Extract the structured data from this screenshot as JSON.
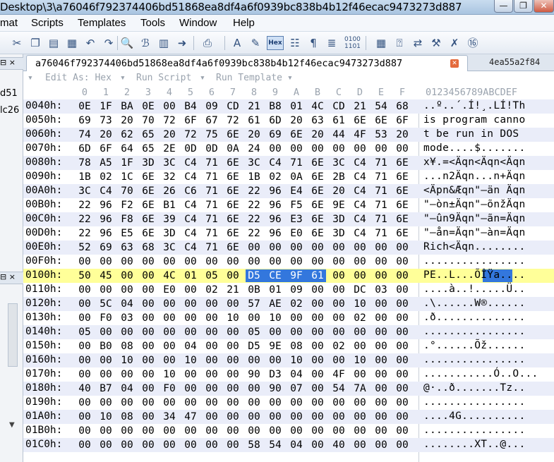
{
  "window": {
    "title": "Desktop\\3\\a76046f792374406bd51868ea8df4a6f0939bc838b4b12f46ecac9473273d887",
    "min_glyph": "—",
    "max_glyph": "❐",
    "close_glyph": "✕"
  },
  "menu": [
    "mat",
    "Scripts",
    "Templates",
    "Tools",
    "Window",
    "Help"
  ],
  "toolbar": {
    "icons": [
      "scissors-icon",
      "copy-icon",
      "paste-icon",
      "paste-special-icon",
      "undo-icon",
      "redo-icon",
      "find-icon",
      "replace-icon",
      "find-in-files-icon",
      "goto-icon",
      "print-icon",
      "font-icon",
      "highlight-icon",
      "hex-mode-icon",
      "text-mode-icon",
      "pilcrow-icon",
      "wrap-icon",
      "binary-icon",
      "calculator-icon",
      "inspector-icon",
      "compare-icon",
      "tools-icon",
      "sum-icon",
      "base-convert-icon"
    ],
    "hex_label": "Hex"
  },
  "left_panel": {
    "lines": [
      "d51",
      "lc26"
    ]
  },
  "tabs": {
    "active": "a76046f792374406bd51868ea8df4a6f0939bc838b4b12f46ecac9473273d887",
    "inactive": "4ea55a2f84"
  },
  "subtoolbar": {
    "edit_as": "Edit As: Hex",
    "run_script": "Run Script",
    "run_template": "Run Template"
  },
  "columns": {
    "hex": [
      "0",
      "1",
      "2",
      "3",
      "4",
      "5",
      "6",
      "7",
      "8",
      "9",
      "A",
      "B",
      "C",
      "D",
      "E",
      "F"
    ],
    "ascii": "0123456789ABCDEF"
  },
  "rows": [
    {
      "address": "0040h:",
      "bytes": [
        "0E",
        "1F",
        "BA",
        "0E",
        "00",
        "B4",
        "09",
        "CD",
        "21",
        "B8",
        "01",
        "4C",
        "CD",
        "21",
        "54",
        "68"
      ],
      "ascii": "..º..´.Í!¸.LÍ!Th"
    },
    {
      "address": "0050h:",
      "bytes": [
        "69",
        "73",
        "20",
        "70",
        "72",
        "6F",
        "67",
        "72",
        "61",
        "6D",
        "20",
        "63",
        "61",
        "6E",
        "6E",
        "6F"
      ],
      "ascii": "is program canno"
    },
    {
      "address": "0060h:",
      "bytes": [
        "74",
        "20",
        "62",
        "65",
        "20",
        "72",
        "75",
        "6E",
        "20",
        "69",
        "6E",
        "20",
        "44",
        "4F",
        "53",
        "20"
      ],
      "ascii": "t be run in DOS "
    },
    {
      "address": "0070h:",
      "bytes": [
        "6D",
        "6F",
        "64",
        "65",
        "2E",
        "0D",
        "0D",
        "0A",
        "24",
        "00",
        "00",
        "00",
        "00",
        "00",
        "00",
        "00"
      ],
      "ascii": "mode....$......."
    },
    {
      "address": "0080h:",
      "bytes": [
        "78",
        "A5",
        "1F",
        "3D",
        "3C",
        "C4",
        "71",
        "6E",
        "3C",
        "C4",
        "71",
        "6E",
        "3C",
        "C4",
        "71",
        "6E"
      ],
      "ascii": "x¥.=<Äqn<Äqn<Äqn"
    },
    {
      "address": "0090h:",
      "bytes": [
        "1B",
        "02",
        "1C",
        "6E",
        "32",
        "C4",
        "71",
        "6E",
        "1B",
        "02",
        "0A",
        "6E",
        "2B",
        "C4",
        "71",
        "6E"
      ],
      "ascii": "...n2Äqn...n+Äqn"
    },
    {
      "address": "00A0h:",
      "bytes": [
        "3C",
        "C4",
        "70",
        "6E",
        "26",
        "C6",
        "71",
        "6E",
        "22",
        "96",
        "E4",
        "6E",
        "20",
        "C4",
        "71",
        "6E"
      ],
      "ascii": "<Äpn&Æqn\"–än Äqn"
    },
    {
      "address": "00B0h:",
      "bytes": [
        "22",
        "96",
        "F2",
        "6E",
        "B1",
        "C4",
        "71",
        "6E",
        "22",
        "96",
        "F5",
        "6E",
        "9E",
        "C4",
        "71",
        "6E"
      ],
      "ascii": "\"–òn±Äqn\"–õnžÄqn"
    },
    {
      "address": "00C0h:",
      "bytes": [
        "22",
        "96",
        "F8",
        "6E",
        "39",
        "C4",
        "71",
        "6E",
        "22",
        "96",
        "E3",
        "6E",
        "3D",
        "C4",
        "71",
        "6E"
      ],
      "ascii": "\"–ûn9Äqn\"–ãn=Äqn"
    },
    {
      "address": "00D0h:",
      "bytes": [
        "22",
        "96",
        "E5",
        "6E",
        "3D",
        "C4",
        "71",
        "6E",
        "22",
        "96",
        "E0",
        "6E",
        "3D",
        "C4",
        "71",
        "6E"
      ],
      "ascii": "\"–ån=Äqn\"–àn=Äqn"
    },
    {
      "address": "00E0h:",
      "bytes": [
        "52",
        "69",
        "63",
        "68",
        "3C",
        "C4",
        "71",
        "6E",
        "00",
        "00",
        "00",
        "00",
        "00",
        "00",
        "00",
        "00"
      ],
      "ascii": "Rich<Äqn........"
    },
    {
      "address": "00F0h:",
      "bytes": [
        "00",
        "00",
        "00",
        "00",
        "00",
        "00",
        "00",
        "00",
        "00",
        "00",
        "00",
        "00",
        "00",
        "00",
        "00",
        "00"
      ],
      "ascii": "................"
    },
    {
      "address": "0100h:",
      "bytes": [
        "50",
        "45",
        "00",
        "00",
        "4C",
        "01",
        "05",
        "00",
        "D5",
        "CE",
        "9F",
        "61",
        "00",
        "00",
        "00",
        "00"
      ],
      "ascii": "PE..L...ÕÎŸa....",
      "highlight": true,
      "selected": [
        8,
        9,
        10,
        11
      ]
    },
    {
      "address": "0110h:",
      "bytes": [
        "00",
        "00",
        "00",
        "00",
        "E0",
        "00",
        "02",
        "21",
        "0B",
        "01",
        "09",
        "00",
        "00",
        "DC",
        "03",
        "00"
      ],
      "ascii": "....à..!.....Ü.."
    },
    {
      "address": "0120h:",
      "bytes": [
        "00",
        "5C",
        "04",
        "00",
        "00",
        "00",
        "00",
        "00",
        "57",
        "AE",
        "02",
        "00",
        "00",
        "10",
        "00",
        "00"
      ],
      "ascii": ".\\......W®......"
    },
    {
      "address": "0130h:",
      "bytes": [
        "00",
        "F0",
        "03",
        "00",
        "00",
        "00",
        "00",
        "10",
        "00",
        "10",
        "00",
        "00",
        "00",
        "02",
        "00",
        "00"
      ],
      "ascii": ".ð.............."
    },
    {
      "address": "0140h:",
      "bytes": [
        "05",
        "00",
        "00",
        "00",
        "00",
        "00",
        "00",
        "00",
        "05",
        "00",
        "00",
        "00",
        "00",
        "00",
        "00",
        "00"
      ],
      "ascii": "................"
    },
    {
      "address": "0150h:",
      "bytes": [
        "00",
        "B0",
        "08",
        "00",
        "00",
        "04",
        "00",
        "00",
        "D5",
        "9E",
        "08",
        "00",
        "02",
        "00",
        "00",
        "00"
      ],
      "ascii": ".°......Õž......"
    },
    {
      "address": "0160h:",
      "bytes": [
        "00",
        "00",
        "10",
        "00",
        "00",
        "10",
        "00",
        "00",
        "00",
        "00",
        "10",
        "00",
        "00",
        "10",
        "00",
        "00"
      ],
      "ascii": "................"
    },
    {
      "address": "0170h:",
      "bytes": [
        "00",
        "00",
        "00",
        "00",
        "10",
        "00",
        "00",
        "00",
        "90",
        "D3",
        "04",
        "00",
        "4F",
        "00",
        "00",
        "00"
      ],
      "ascii": "...........Ó..O..."
    },
    {
      "address": "0180h:",
      "bytes": [
        "40",
        "B7",
        "04",
        "00",
        "F0",
        "00",
        "00",
        "00",
        "00",
        "90",
        "07",
        "00",
        "54",
        "7A",
        "00",
        "00"
      ],
      "ascii": "@·..ð.......Tz.."
    },
    {
      "address": "0190h:",
      "bytes": [
        "00",
        "00",
        "00",
        "00",
        "00",
        "00",
        "00",
        "00",
        "00",
        "00",
        "00",
        "00",
        "00",
        "00",
        "00",
        "00"
      ],
      "ascii": "................"
    },
    {
      "address": "01A0h:",
      "bytes": [
        "00",
        "10",
        "08",
        "00",
        "34",
        "47",
        "00",
        "00",
        "00",
        "00",
        "00",
        "00",
        "00",
        "00",
        "00",
        "00"
      ],
      "ascii": "....4G.........."
    },
    {
      "address": "01B0h:",
      "bytes": [
        "00",
        "00",
        "00",
        "00",
        "00",
        "00",
        "00",
        "00",
        "00",
        "00",
        "00",
        "00",
        "00",
        "00",
        "00",
        "00"
      ],
      "ascii": "................"
    },
    {
      "address": "01C0h:",
      "bytes": [
        "00",
        "00",
        "00",
        "00",
        "00",
        "00",
        "00",
        "00",
        "58",
        "54",
        "04",
        "00",
        "40",
        "00",
        "00",
        "00"
      ],
      "ascii": "........XT..@..."
    }
  ]
}
